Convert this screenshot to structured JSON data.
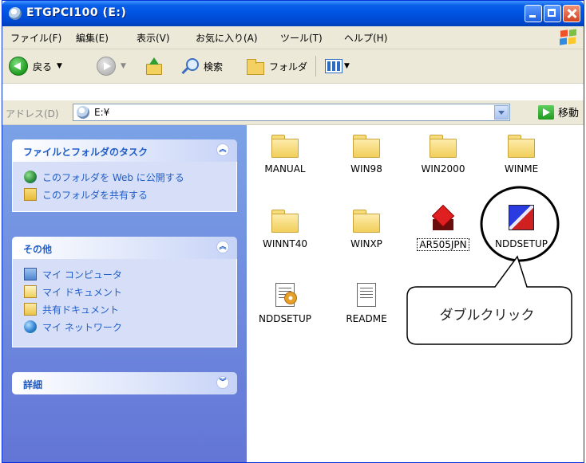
{
  "window": {
    "title": "ETGPCI100 (E:)"
  },
  "menu": [
    "ファイル(F)",
    "編集(E)",
    "表示(V)",
    "お気に入り(A)",
    "ツール(T)",
    "ヘルプ(H)"
  ],
  "toolbar": {
    "back": "戻る",
    "search": "検索",
    "folders": "フォルダ"
  },
  "address": {
    "label": "アドレス(D)",
    "value": "E:¥",
    "go": "移動"
  },
  "taskpane": {
    "panels": [
      {
        "title": "ファイルとフォルダのタスク",
        "items": [
          "このフォルダを Web に公開する",
          "このフォルダを共有する"
        ]
      },
      {
        "title": "その他",
        "items": [
          "マイ コンピュータ",
          "マイ ドキュメント",
          "共有ドキュメント",
          "マイ ネットワーク"
        ]
      },
      {
        "title": "詳細",
        "items": []
      }
    ]
  },
  "files": [
    "MANUAL",
    "WIN98",
    "WIN2000",
    "WINME",
    "WINNT40",
    "WINXP",
    "AR505JPN",
    "NDDSETUP",
    "NDDSETUP",
    "README"
  ],
  "annotation": {
    "callout": "ダブルクリック"
  }
}
